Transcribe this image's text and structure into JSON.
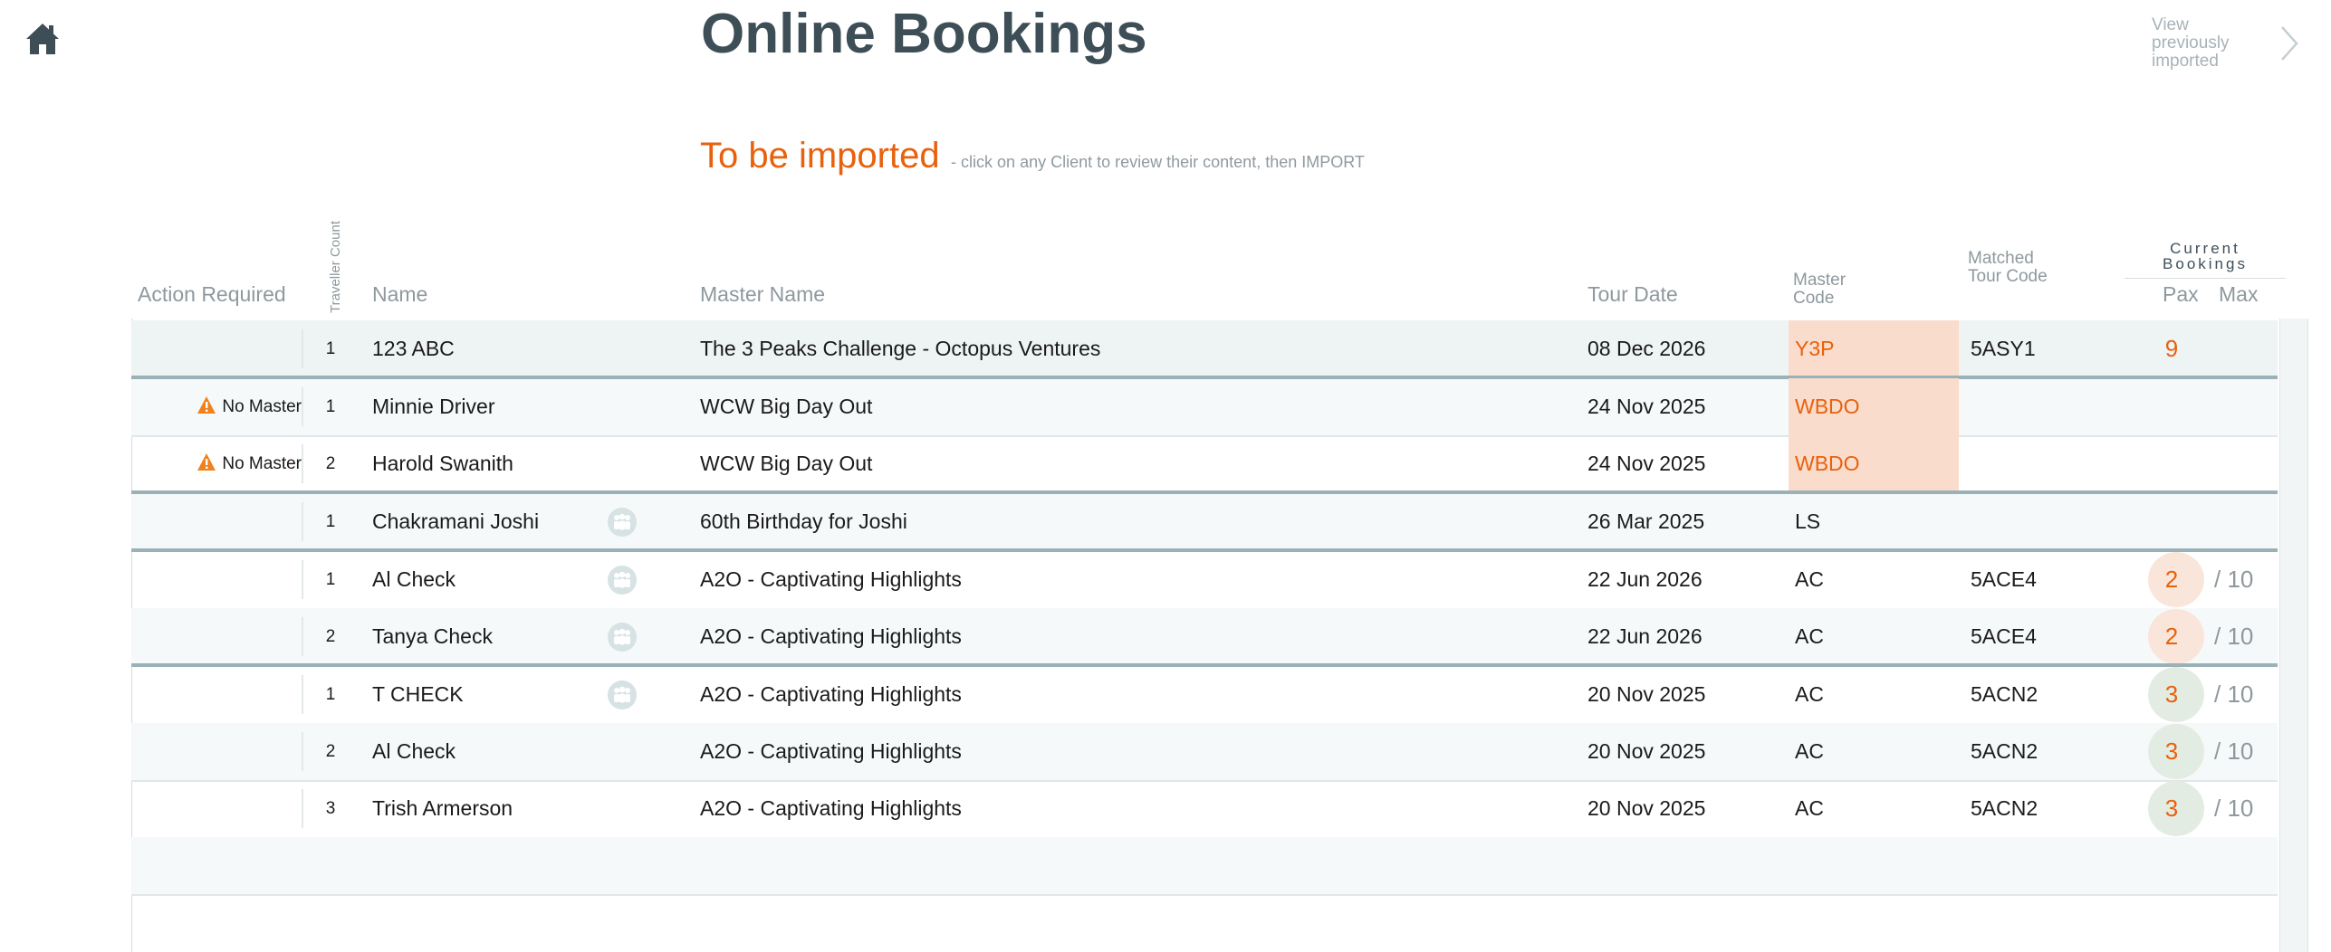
{
  "header": {
    "title": "Online Bookings",
    "view_previous": "View previously imported"
  },
  "section": {
    "title": "To be imported",
    "hint": "- click on any Client to review their content, then IMPORT"
  },
  "columns": {
    "action": "Action Required",
    "traveller_count": "Traveller Count",
    "name": "Name",
    "master_name": "Master Name",
    "tour_date": "Tour Date",
    "master_code": "Master Code",
    "matched_tour_code": "Matched Tour Code",
    "current_bookings": "Current Bookings",
    "pax": "Pax",
    "max": "Max"
  },
  "icons": {
    "home": "home-icon",
    "chevron": "chevron-right-icon",
    "warning": "warning-icon",
    "group": "group-icon"
  },
  "colors": {
    "accent": "#e8610d",
    "title": "#3e4e57",
    "code_highlight": "#f9dccb",
    "pax_orange_bg": "#fae5da",
    "pax_green_bg": "#e3ece3"
  },
  "rows": [
    {
      "action": "",
      "count": "1",
      "name": "123 ABC",
      "group": false,
      "master_name": "The 3 Peaks Challenge - Octopus Ventures",
      "tour_date": "08 Dec 2026",
      "master_code": "Y3P",
      "code_highlight": true,
      "matched": "5ASY1",
      "pax": "9",
      "pax_style": "",
      "max": ""
    },
    {
      "action": "No Master",
      "count": "1",
      "name": "Minnie Driver",
      "group": false,
      "master_name": "WCW Big Day Out",
      "tour_date": "24 Nov 2025",
      "master_code": "WBDO",
      "code_highlight": true,
      "matched": "",
      "pax": "",
      "pax_style": "",
      "max": ""
    },
    {
      "action": "No Master",
      "count": "2",
      "name": "Harold Swanith",
      "group": false,
      "master_name": "WCW Big Day Out",
      "tour_date": "24 Nov 2025",
      "master_code": "WBDO",
      "code_highlight": true,
      "matched": "",
      "pax": "",
      "pax_style": "",
      "max": ""
    },
    {
      "action": "",
      "count": "1",
      "name": "Chakramani Joshi",
      "group": true,
      "master_name": "60th Birthday for Joshi",
      "tour_date": "26 Mar 2025",
      "master_code": "LS",
      "code_highlight": false,
      "matched": "",
      "pax": "",
      "pax_style": "",
      "max": ""
    },
    {
      "action": "",
      "count": "1",
      "name": "Al Check",
      "group": true,
      "master_name": "A2O - Captivating Highlights",
      "tour_date": "22 Jun 2026",
      "master_code": "AC",
      "code_highlight": false,
      "matched": "5ACE4",
      "pax": "2",
      "pax_style": "orange",
      "max": "/ 10"
    },
    {
      "action": "",
      "count": "2",
      "name": "Tanya Check",
      "group": true,
      "master_name": "A2O - Captivating Highlights",
      "tour_date": "22 Jun 2026",
      "master_code": "AC",
      "code_highlight": false,
      "matched": "5ACE4",
      "pax": "2",
      "pax_style": "orange",
      "max": "/ 10"
    },
    {
      "action": "",
      "count": "1",
      "name": "T CHECK",
      "group": true,
      "master_name": "A2O - Captivating Highlights",
      "tour_date": "20 Nov 2025",
      "master_code": "AC",
      "code_highlight": false,
      "matched": "5ACN2",
      "pax": "3",
      "pax_style": "green",
      "max": "/ 10"
    },
    {
      "action": "",
      "count": "2",
      "name": "Al Check",
      "group": false,
      "master_name": "A2O - Captivating Highlights",
      "tour_date": "20 Nov 2025",
      "master_code": "AC",
      "code_highlight": false,
      "matched": "5ACN2",
      "pax": "3",
      "pax_style": "green",
      "max": "/ 10"
    },
    {
      "action": "",
      "count": "3",
      "name": "Trish Armerson",
      "group": false,
      "master_name": "A2O - Captivating Highlights",
      "tour_date": "20 Nov 2025",
      "master_code": "AC",
      "code_highlight": false,
      "matched": "5ACN2",
      "pax": "3",
      "pax_style": "green",
      "max": "/ 10"
    }
  ]
}
